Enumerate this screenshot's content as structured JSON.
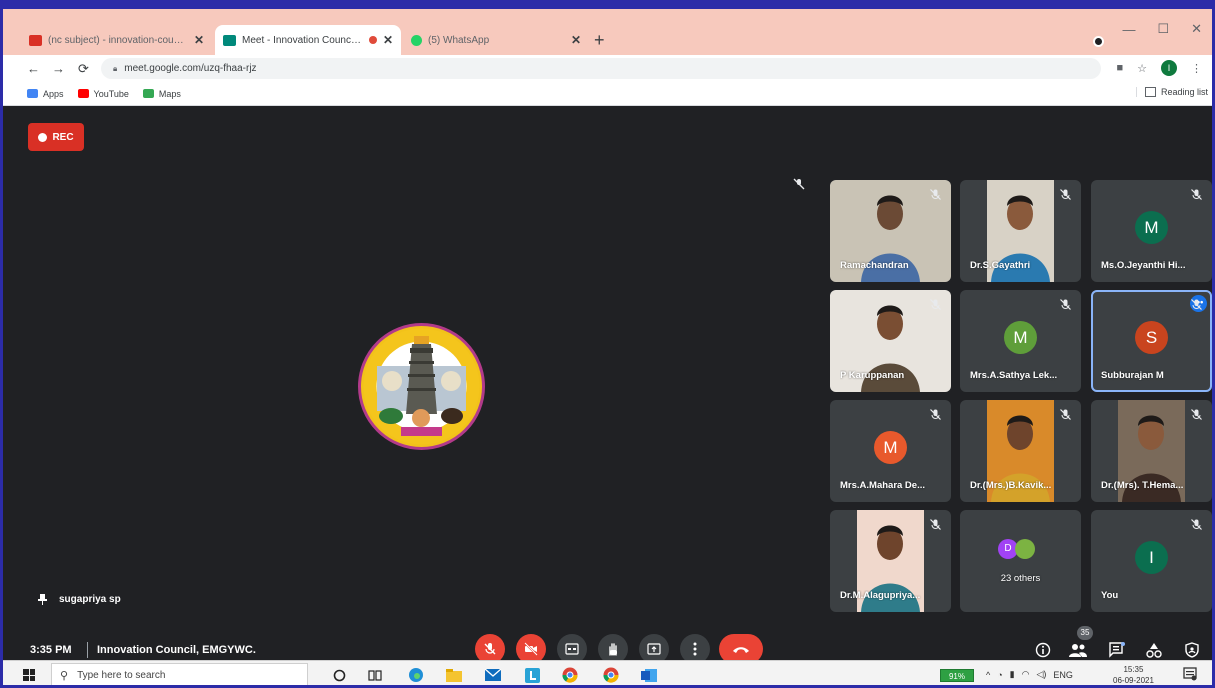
{
  "browser": {
    "tabs": [
      {
        "title": "(nc subject) - innovation-council",
        "active": false,
        "favicon_color": "#d93025"
      },
      {
        "title": "Meet - Innovation Council, E",
        "active": true,
        "favicon_color": "#00897b"
      },
      {
        "title": "(5) WhatsApp",
        "active": false,
        "favicon_color": "#25d366"
      }
    ],
    "url": "meet.google.com/uzq-fhaa-rjz",
    "account_initial": "I",
    "bookmarks": [
      {
        "label": "Apps",
        "color": "#4285f4"
      },
      {
        "label": "YouTube",
        "color": "#ff0000"
      },
      {
        "label": "Maps",
        "color": "#34a853"
      }
    ],
    "reading_list": "Reading list"
  },
  "meet": {
    "rec_label": "REC",
    "speaker_name": "sugapriya sp",
    "time": "3:35 PM",
    "meeting_title": "Innovation Council, EMGYWC.",
    "people_count": "35",
    "participants": [
      {
        "name": "Ramachandran",
        "type": "video",
        "skin": "#6b4a35",
        "shirt": "#4a6fa5",
        "bg": "#c9c3b5"
      },
      {
        "name": "Dr.S.Gayathri",
        "type": "video",
        "skin": "#8a5a3c",
        "shirt": "#2a7ab0",
        "bg": "#d8d2c6"
      },
      {
        "name": "Ms.O.Jeyanthi Hi...",
        "type": "avatar",
        "initial": "M",
        "color": "#0b6e4f"
      },
      {
        "name": "P Karuppanan",
        "type": "video",
        "skin": "#7a4e33",
        "shirt": "#5a4b3a",
        "bg": "#e8e4de"
      },
      {
        "name": "Mrs.A.Sathya Lek...",
        "type": "avatar",
        "initial": "M",
        "color": "#5f9e3a"
      },
      {
        "name": "Subburajan M",
        "type": "avatar",
        "initial": "S",
        "color": "#c9441e"
      },
      {
        "name": "Mrs.A.Mahara De...",
        "type": "avatar",
        "initial": "M",
        "color": "#e8592c"
      },
      {
        "name": "Dr.(Mrs.)B.Kavik...",
        "type": "video",
        "skin": "#6e442c",
        "shirt": "#d4a22a",
        "bg": "#d98a2a"
      },
      {
        "name": "Dr.(Mrs). T.Hema...",
        "type": "video",
        "skin": "#8a5a3c",
        "shirt": "#3a2a24",
        "bg": "#7a6a5a"
      },
      {
        "name": "Dr.M.Alagupriya...",
        "type": "video",
        "skin": "#6e442c",
        "shirt": "#2f7c8a",
        "bg": "#f0d8cc"
      },
      {
        "name": "23 others",
        "type": "others",
        "initial": "D"
      },
      {
        "name": "You",
        "type": "avatar",
        "initial": "I",
        "color": "#0b6e4f"
      }
    ]
  },
  "taskbar": {
    "search_placeholder": "Type here to search",
    "battery": "91%",
    "language": "ENG",
    "clock_time": "15:35",
    "clock_date": "06-09-2021"
  }
}
